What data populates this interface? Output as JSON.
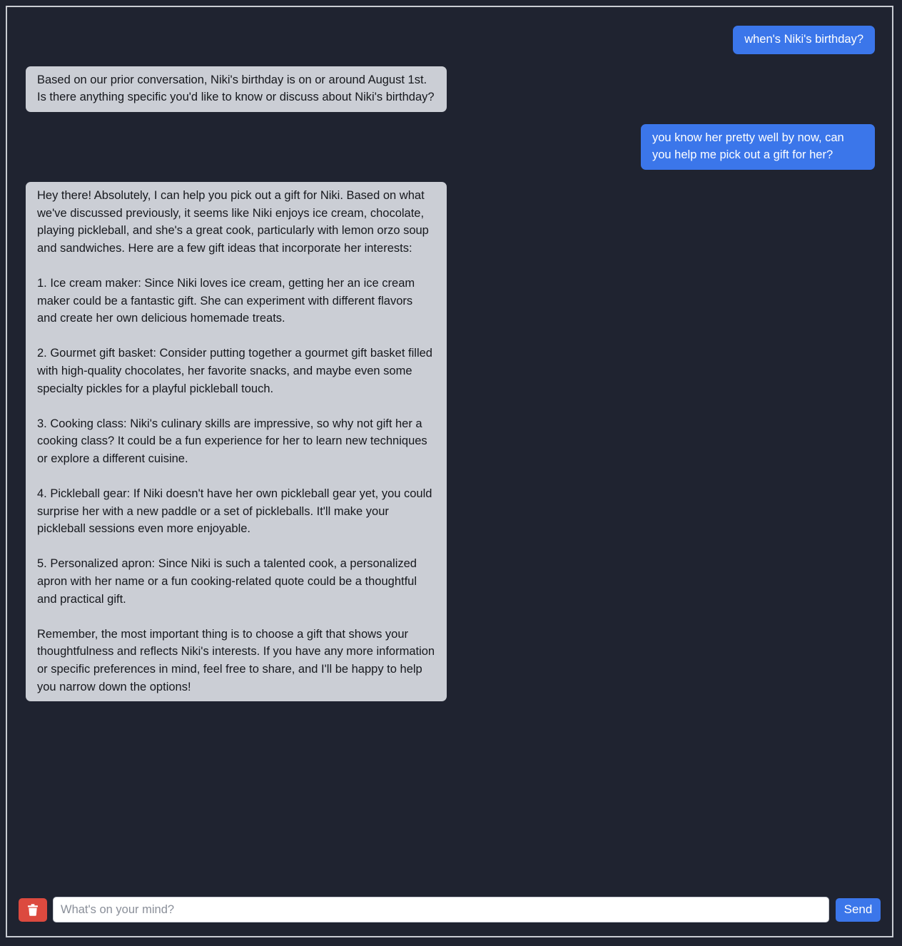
{
  "messages": [
    {
      "role": "user",
      "text": "when's Niki's birthday?"
    },
    {
      "role": "bot",
      "text": "Based on our prior conversation, Niki's birthday is on or around August 1st. Is there anything specific you'd like to know or discuss about Niki's birthday?"
    },
    {
      "role": "user",
      "text": "you know her pretty well by now, can you help me pick out a gift for her?"
    },
    {
      "role": "bot",
      "text": "Hey there! Absolutely, I can help you pick out a gift for Niki. Based on what we've discussed previously, it seems like Niki enjoys ice cream, chocolate, playing pickleball, and she's a great cook, particularly with lemon orzo soup and sandwiches. Here are a few gift ideas that incorporate her interests:\n\n1. Ice cream maker: Since Niki loves ice cream, getting her an ice cream maker could be a fantastic gift. She can experiment with different flavors and create her own delicious homemade treats.\n\n2. Gourmet gift basket: Consider putting together a gourmet gift basket filled with high-quality chocolates, her favorite snacks, and maybe even some specialty pickles for a playful pickleball touch.\n\n3. Cooking class: Niki's culinary skills are impressive, so why not gift her a cooking class? It could be a fun experience for her to learn new techniques or explore a different cuisine.\n\n4. Pickleball gear: If Niki doesn't have her own pickleball gear yet, you could surprise her with a new paddle or a set of pickleballs. It'll make your pickleball sessions even more enjoyable.\n\n5. Personalized apron: Since Niki is such a talented cook, a personalized apron with her name or a fun cooking-related quote could be a thoughtful and practical gift.\n\nRemember, the most important thing is to choose a gift that shows your thoughtfulness and reflects Niki's interests. If you have any more information or specific preferences in mind, feel free to share, and I'll be happy to help you narrow down the options!"
    }
  ],
  "composer": {
    "placeholder": "What's on your mind?",
    "value": "",
    "send_label": "Send",
    "clear_icon": "trash-icon"
  },
  "colors": {
    "background": "#1f2330",
    "user_bubble": "#3b76ea",
    "bot_bubble": "#cbced5",
    "clear_button": "#dc4a3f",
    "send_button": "#3b76ea"
  }
}
